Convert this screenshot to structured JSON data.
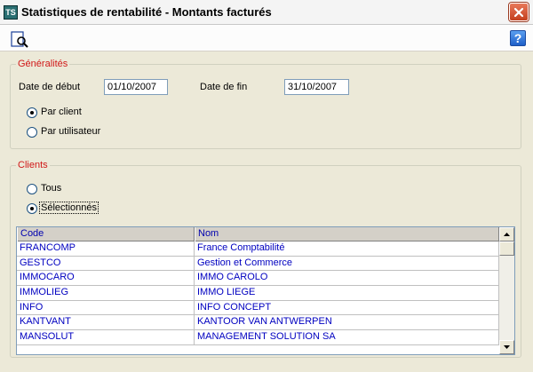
{
  "window": {
    "title": "Statistiques de rentabilité - Montants facturés",
    "app_icon": "TS"
  },
  "toolbar": {
    "search_icon": "preview-search-icon",
    "help_label": "?"
  },
  "generalites": {
    "legend": "Généralités",
    "date_debut_label": "Date de début",
    "date_debut_value": "01/10/2007",
    "date_fin_label": "Date de fin",
    "date_fin_value": "31/10/2007",
    "radio_par_client": "Par client",
    "radio_par_utilisateur": "Par utilisateur",
    "selected": "Par client"
  },
  "clients": {
    "legend": "Clients",
    "radio_tous": "Tous",
    "radio_selectionnes": "Sélectionnés",
    "selected": "Sélectionnés",
    "columns": [
      "Code",
      "Nom"
    ],
    "rows": [
      {
        "code": "FRANCOMP",
        "nom": "France Comptabilité"
      },
      {
        "code": "GESTCO",
        "nom": "Gestion et Commerce"
      },
      {
        "code": "IMMOCARO",
        "nom": "IMMO CAROLO"
      },
      {
        "code": "IMMOLIEG",
        "nom": "IMMO LIEGE"
      },
      {
        "code": "INFO",
        "nom": "INFO CONCEPT"
      },
      {
        "code": "KANTVANT",
        "nom": "KANTOOR VAN ANTWERPEN"
      },
      {
        "code": "MANSOLUT",
        "nom": "MANAGEMENT SOLUTION SA"
      }
    ]
  },
  "colors": {
    "legend": "#d01818",
    "cell_text": "#0000c0",
    "header_text": "#0000b0"
  }
}
